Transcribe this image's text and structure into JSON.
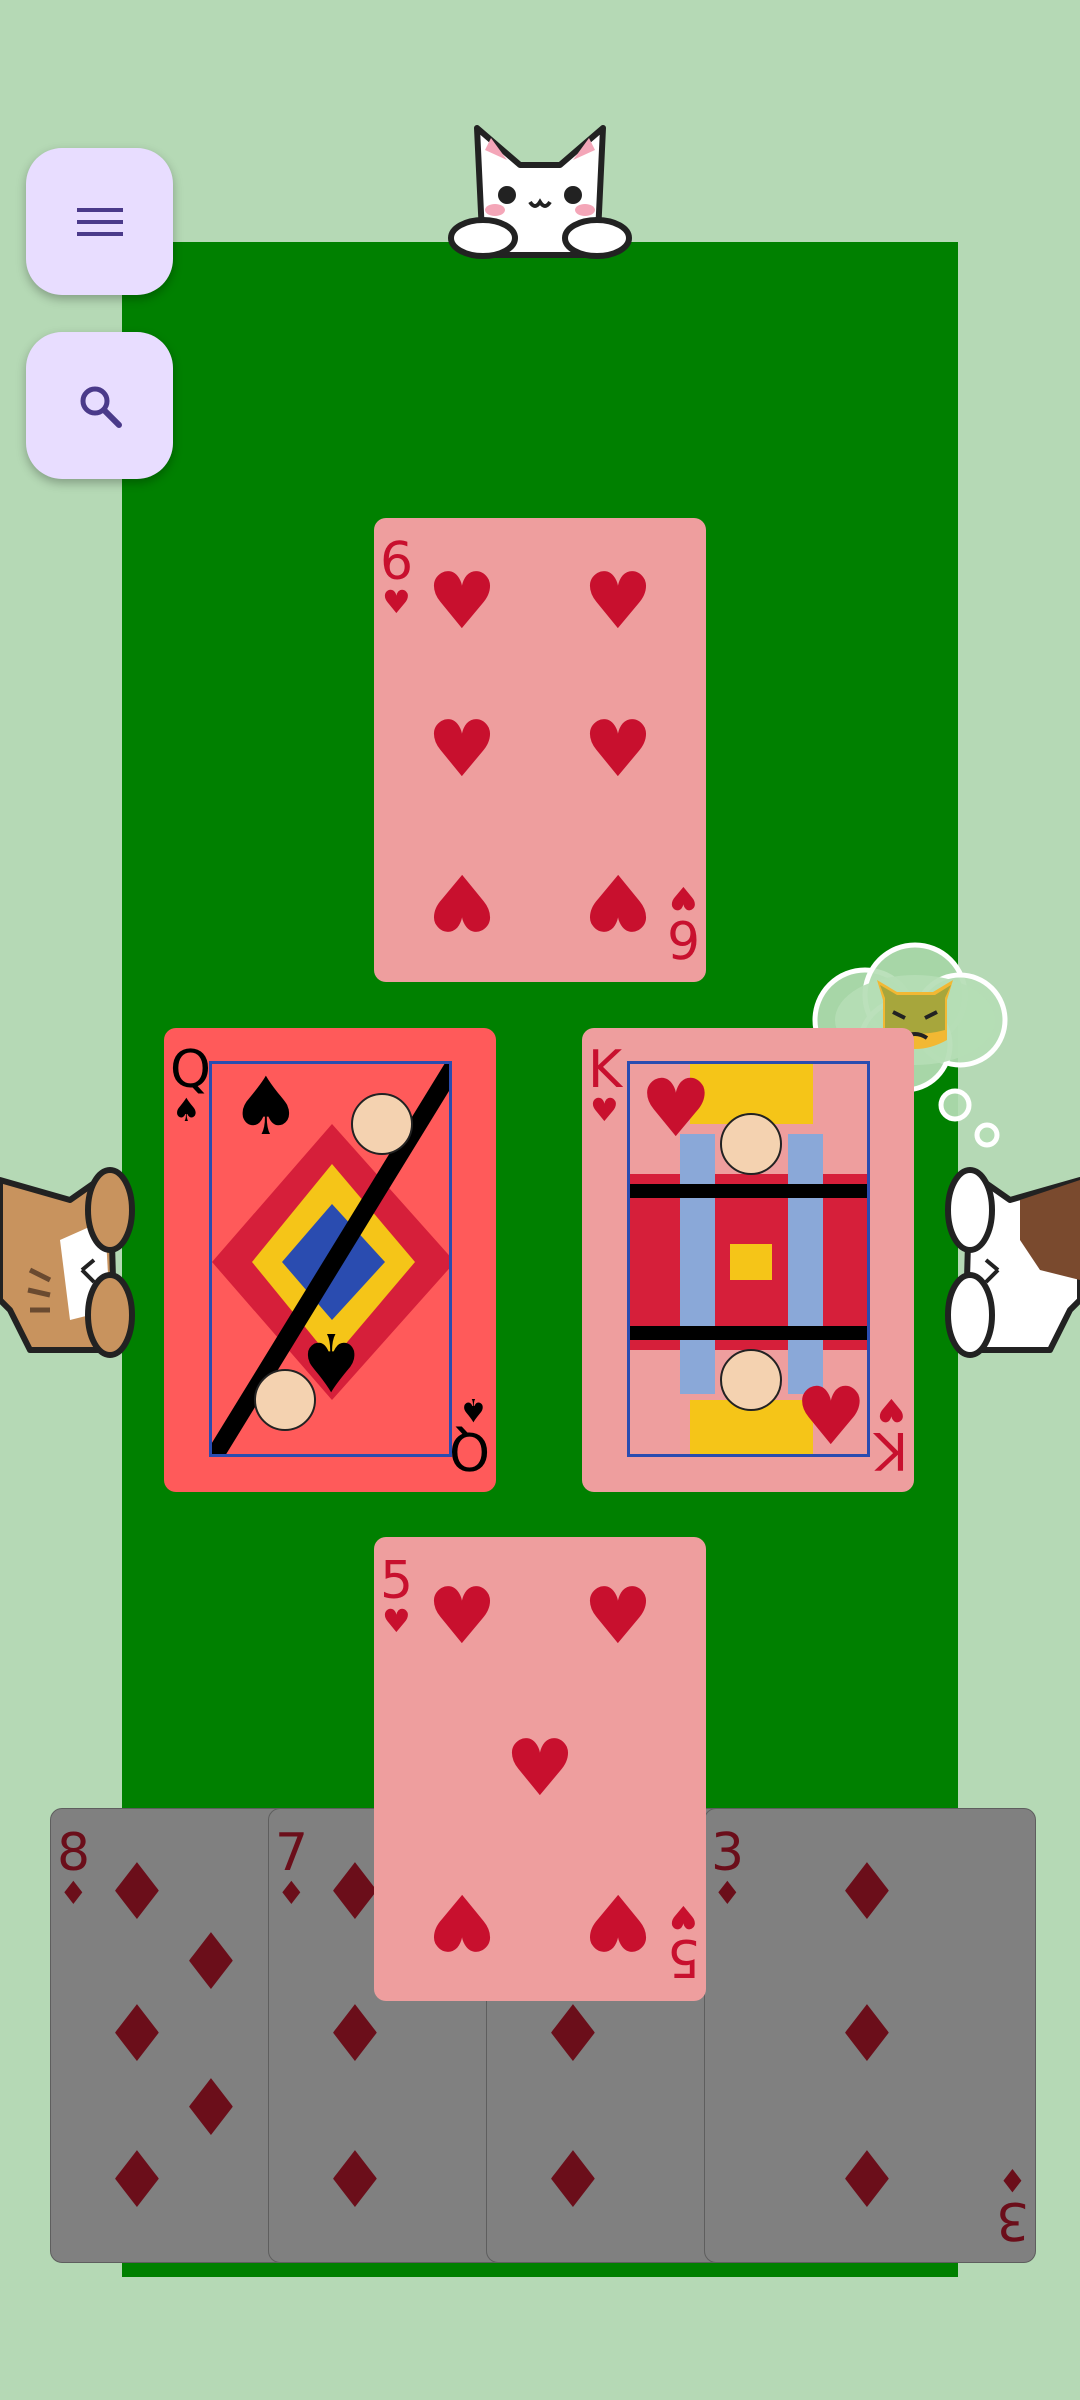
{
  "controls": {
    "menu_icon": "hamburger-menu-icon",
    "search_icon": "search-icon"
  },
  "colors": {
    "background": "#b5d9b5",
    "table": "#008000",
    "fab": "#e8ddff",
    "card_played": "#ee9e9e",
    "card_hand": "#808080",
    "card_highlight": "#ff5a5a",
    "suit_red": "#c8102e"
  },
  "players": {
    "top": {
      "avatar": "white-cat"
    },
    "left": {
      "avatar": "tabby-cat"
    },
    "right": {
      "avatar": "calico-cat",
      "thought": "angry-cat-face-emoji"
    }
  },
  "trick": {
    "top_card": {
      "rank": "6",
      "suit": "♥"
    },
    "left_card": {
      "rank": "Q",
      "suit": "♠"
    },
    "right_card": {
      "rank": "K",
      "suit": "♥"
    },
    "bottom_card": {
      "rank": "5",
      "suit": "♥"
    }
  },
  "hand": [
    {
      "rank": "8",
      "suit": "♦"
    },
    {
      "rank": "7",
      "suit": "♦"
    },
    {
      "rank": "",
      "suit": "♦"
    },
    {
      "rank": "3",
      "suit": "♦"
    }
  ]
}
